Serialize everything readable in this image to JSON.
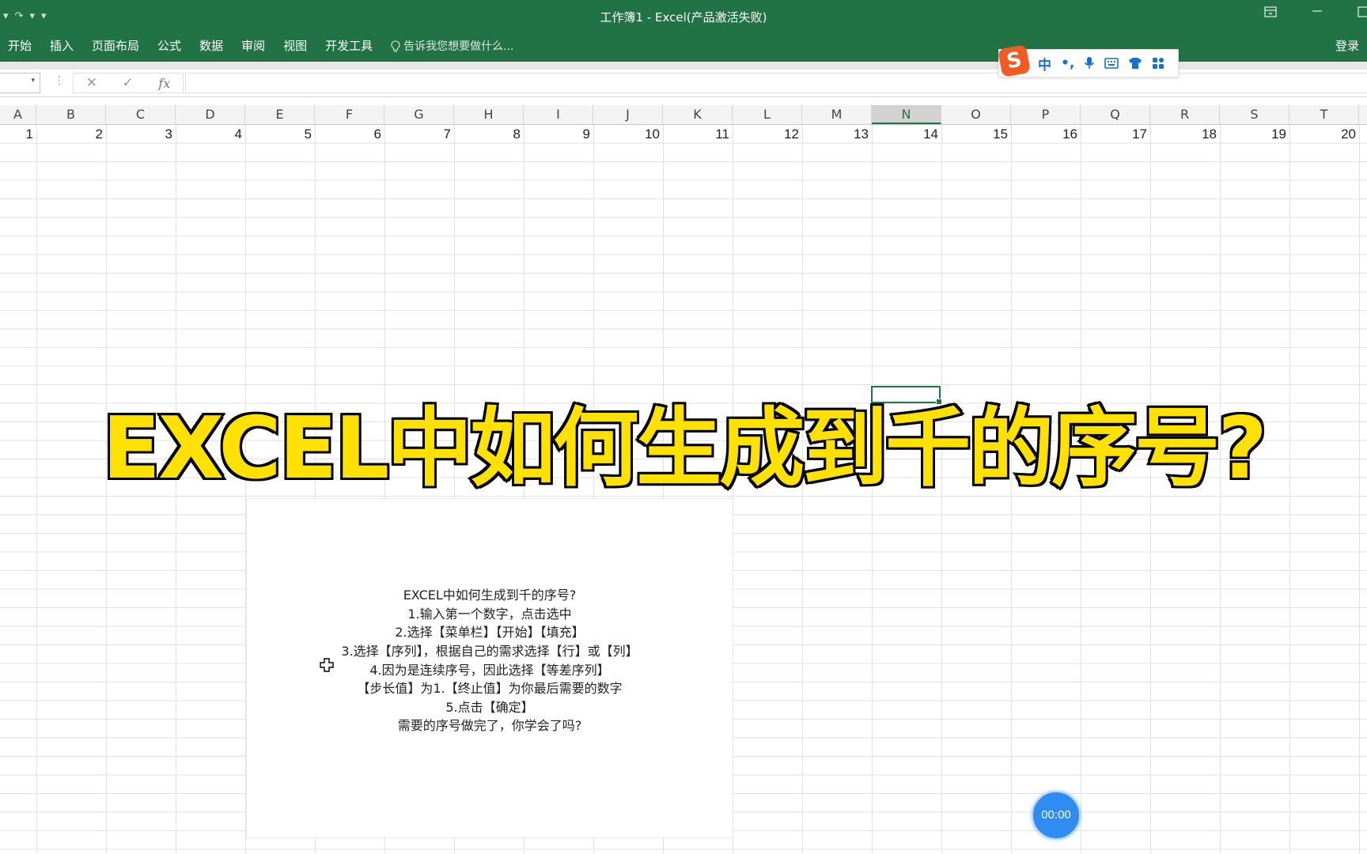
{
  "window": {
    "title": "工作簿1 - Excel(产品激活失败)",
    "quick_access": [
      "▾",
      "↷",
      "▾",
      "▾"
    ],
    "controls": [
      "restore-ribbon",
      "minimize",
      "maximize"
    ]
  },
  "ribbon": {
    "tabs": [
      "开始",
      "插入",
      "页面布局",
      "公式",
      "数据",
      "审阅",
      "视图",
      "开发工具"
    ],
    "tell_me": "告诉我您想要做什么...",
    "login": "登录"
  },
  "formula_bar": {
    "name_box": "",
    "cancel": "✕",
    "enter": "✓",
    "fx": "fx",
    "value": ""
  },
  "ime_toolbar": {
    "logo": "S",
    "mode": "中",
    "punct": "•,",
    "icons": [
      "microphone-icon",
      "keyboard-icon",
      "skin-icon",
      "apps-icon"
    ]
  },
  "columns": [
    "A",
    "B",
    "C",
    "D",
    "E",
    "F",
    "G",
    "H",
    "I",
    "J",
    "K",
    "L",
    "M",
    "N",
    "O",
    "P",
    "Q",
    "R",
    "S",
    "T"
  ],
  "selected_column": "N",
  "row1_values": [
    "1",
    "2",
    "3",
    "4",
    "5",
    "6",
    "7",
    "8",
    "9",
    "10",
    "11",
    "12",
    "13",
    "14",
    "15",
    "16",
    "17",
    "18",
    "19",
    "20"
  ],
  "overlay_title": "EXCEL中如何生成到千的序号?",
  "note_lines": [
    "EXCEL中如何生成到千的序号?",
    "1.输入第一个数字，点击选中",
    "2.选择【菜单栏】【开始】【填充】",
    "3.选择【序列】，根据自己的需求选择【行】或【列】",
    "4.因为是连续序号，因此选择【等差序列】",
    "【步长值】为1.【终止值】为你最后需要的数字",
    "5.点击【确定】",
    "需要的序号做完了，你学会了吗?"
  ],
  "timer": "00:00",
  "colors": {
    "excel_green": "#217346",
    "title_yellow": "#ffe100",
    "timer_blue": "#2f8cf2"
  }
}
